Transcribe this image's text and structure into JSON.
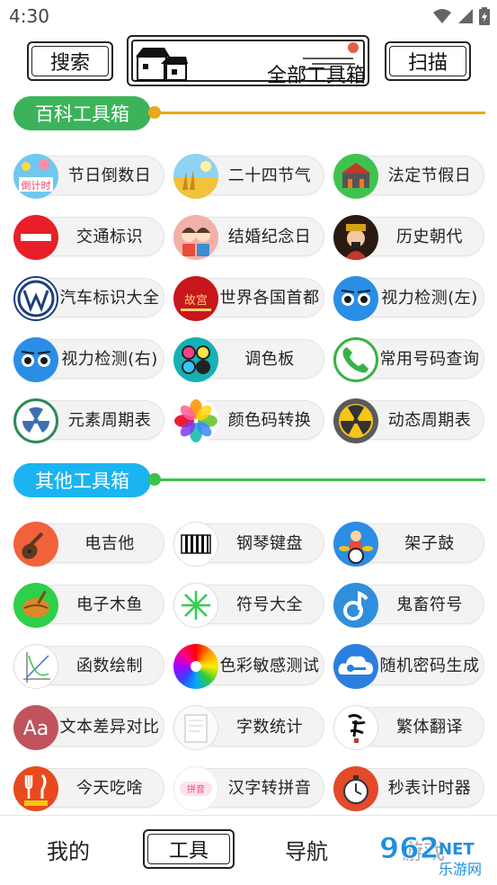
{
  "status": {
    "time": "4:30"
  },
  "header": {
    "search_label": "搜索",
    "title": "全部工具箱",
    "scan_label": "扫描"
  },
  "sections": [
    {
      "title": "百科工具箱",
      "color": "#3cb35a",
      "line_color": "#e8a81c",
      "items": [
        {
          "label": "节日倒数日",
          "icon": "festival-countdown-icon"
        },
        {
          "label": "二十四节气",
          "icon": "solar-terms-icon"
        },
        {
          "label": "法定节假日",
          "icon": "legal-holiday-icon"
        },
        {
          "label": "交通标识",
          "icon": "no-entry-sign-icon"
        },
        {
          "label": "结婚纪念日",
          "icon": "wedding-couple-icon"
        },
        {
          "label": "历史朝代",
          "icon": "emperor-icon"
        },
        {
          "label": "汽车标识大全",
          "icon": "car-logo-icon"
        },
        {
          "label": "世界各国首都",
          "icon": "world-capitals-icon"
        },
        {
          "label": "视力检测(左)",
          "icon": "eye-left-icon"
        },
        {
          "label": "视力检测(右)",
          "icon": "eye-right-icon"
        },
        {
          "label": "调色板",
          "icon": "palette-icon"
        },
        {
          "label": "常用号码查询",
          "icon": "phone-icon"
        },
        {
          "label": "元素周期表",
          "icon": "radiation-green-icon"
        },
        {
          "label": "颜色码转换",
          "icon": "color-flower-icon"
        },
        {
          "label": "动态周期表",
          "icon": "radiation-yellow-icon"
        }
      ]
    },
    {
      "title": "其他工具箱",
      "color": "#1bb4f0",
      "line_color": "#3cc24a",
      "items": [
        {
          "label": "电吉他",
          "icon": "guitar-icon"
        },
        {
          "label": "钢琴键盘",
          "icon": "piano-icon"
        },
        {
          "label": "架子鼓",
          "icon": "drum-kit-icon"
        },
        {
          "label": "电子木鱼",
          "icon": "wooden-fish-icon"
        },
        {
          "label": "符号大全",
          "icon": "symbol-star-icon"
        },
        {
          "label": "鬼畜符号",
          "icon": "music-note-icon"
        },
        {
          "label": "函数绘制",
          "icon": "function-graph-icon"
        },
        {
          "label": "色彩敏感测试",
          "icon": "color-wheel-icon"
        },
        {
          "label": "随机密码生成",
          "icon": "cloud-key-icon"
        },
        {
          "label": "文本差异对比",
          "icon": "text-aa-icon"
        },
        {
          "label": "字数统计",
          "icon": "word-count-icon"
        },
        {
          "label": "繁体翻译",
          "icon": "calligraphy-icon"
        },
        {
          "label": "今天吃啥",
          "icon": "fork-knife-icon"
        },
        {
          "label": "汉字转拼音",
          "icon": "pinyin-icon"
        },
        {
          "label": "秒表计时器",
          "icon": "stopwatch-icon"
        }
      ]
    }
  ],
  "nav": {
    "mine": "我的",
    "tools": "工具",
    "navigation": "导航",
    "game": "游戏"
  },
  "watermark": {
    "brand": "962",
    "suffix": "NET",
    "caption": "乐游网"
  }
}
